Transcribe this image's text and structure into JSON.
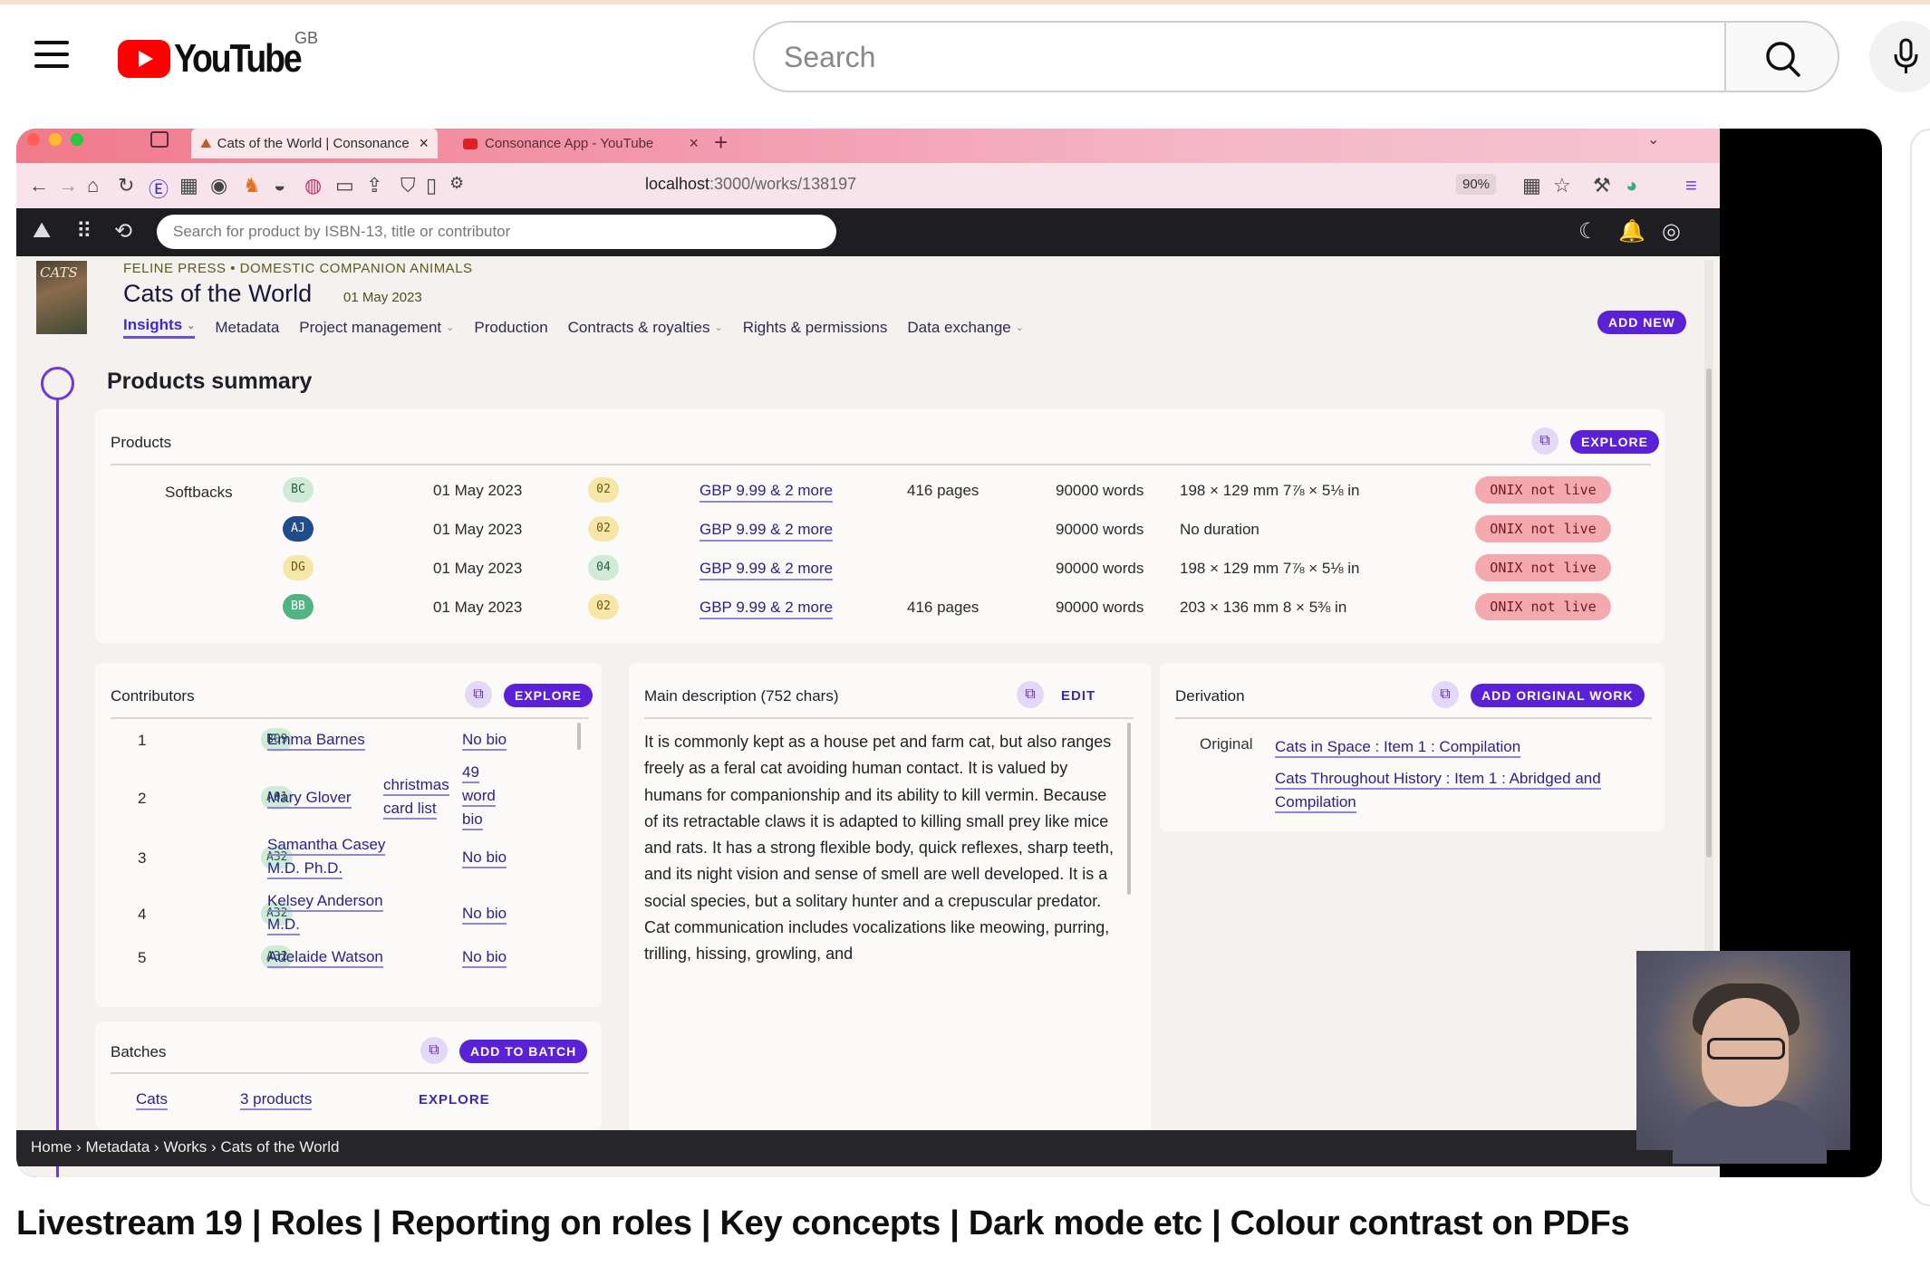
{
  "youtube": {
    "country": "GB",
    "logo_text": "YouTube",
    "search_placeholder": "Search",
    "video_title": "Livestream 19 | Roles | Reporting on roles | Key concepts | Dark mode etc | Colour contrast on PDFs"
  },
  "browser": {
    "tabs": [
      {
        "label": "Cats of the World | Consonance"
      },
      {
        "label": "Consonance App - YouTube"
      }
    ],
    "url_host": "localhost",
    "url_path": ":3000/works/138197",
    "zoom": "90%"
  },
  "app": {
    "search_placeholder": "Search for product by ISBN-13, title or contributor",
    "cover_text": "CATS",
    "imprint": "FELINE PRESS • DOMESTIC COMPANION ANIMALS",
    "work_title": "Cats of the World",
    "work_date": "01 May 2023",
    "nav": [
      {
        "label": "Insights",
        "chevron": true,
        "selected": true
      },
      {
        "label": "Metadata",
        "chevron": false
      },
      {
        "label": "Project management",
        "chevron": true
      },
      {
        "label": "Production",
        "chevron": false
      },
      {
        "label": "Contracts & royalties",
        "chevron": true
      },
      {
        "label": "Rights & permissions",
        "chevron": false
      },
      {
        "label": "Data exchange",
        "chevron": true
      }
    ],
    "add_new": "ADD NEW",
    "section_title": "Products summary",
    "products": {
      "heading": "Products",
      "explore": "EXPLORE",
      "group": "Softbacks",
      "rows": [
        {
          "code": "BC",
          "code_style": "green",
          "date": "01 May 2023",
          "status": "02",
          "status_style": "yellow",
          "price": "GBP 9.99 & 2 more",
          "pages": "416 pages",
          "words": "90000 words",
          "dims": "198 × 129 mm 7⅞ × 5⅛ in",
          "onix": "ONIX not live"
        },
        {
          "code": "AJ",
          "code_style": "blue",
          "date": "01 May 2023",
          "status": "02",
          "status_style": "yellow",
          "price": "GBP 9.99 & 2 more",
          "pages": "",
          "words": "90000 words",
          "dims": "No duration",
          "onix": "ONIX not live"
        },
        {
          "code": "DG",
          "code_style": "yellow",
          "date": "01 May 2023",
          "status": "04",
          "status_style": "green",
          "price": "GBP 9.99 & 2 more",
          "pages": "",
          "words": "90000 words",
          "dims": "198 × 129 mm 7⅞ × 5⅛ in",
          "onix": "ONIX not live"
        },
        {
          "code": "BB",
          "code_style": "teal",
          "date": "01 May 2023",
          "status": "02",
          "status_style": "yellow",
          "price": "GBP 9.99 & 2 more",
          "pages": "416 pages",
          "words": "90000 words",
          "dims": "203 × 136 mm 8 × 5⅜ in",
          "onix": "ONIX not live"
        }
      ]
    },
    "contributors": {
      "heading": "Contributors",
      "explore": "EXPLORE",
      "rows": [
        {
          "n": "1",
          "role": "B09",
          "name_lines": [
            "Emma Barnes"
          ],
          "list_lines": [],
          "bio_lines": [
            "No bio"
          ]
        },
        {
          "n": "2",
          "role": "A01",
          "name_lines": [
            "Mary Glover"
          ],
          "list_lines": [
            "christmas",
            "card list"
          ],
          "bio_lines": [
            "49",
            "word",
            "bio"
          ]
        },
        {
          "n": "3",
          "role": "A32",
          "name_lines": [
            "Samantha Casey",
            "M.D. Ph.D."
          ],
          "list_lines": [],
          "bio_lines": [
            "No bio"
          ]
        },
        {
          "n": "4",
          "role": "A32",
          "name_lines": [
            "Kelsey Anderson",
            "M.D."
          ],
          "list_lines": [],
          "bio_lines": [
            "No bio"
          ]
        },
        {
          "n": "5",
          "role": "A32",
          "name_lines": [
            "Adelaide Watson"
          ],
          "list_lines": [],
          "bio_lines": [
            "No bio"
          ]
        }
      ]
    },
    "description": {
      "heading": "Main description (752 chars)",
      "edit": "EDIT",
      "text": "It is commonly kept as a house pet and farm cat, but also ranges freely as a feral cat avoiding human contact. It is valued by humans for companionship and its ability to kill vermin. Because of its retractable claws it is adapted to killing small prey like mice and rats. It has a strong flexible body, quick reflexes, sharp teeth, and its night vision and sense of smell are well developed. It is a social species, but a solitary hunter and a crepuscular predator. Cat communication includes vocalizations like meowing, purring, trilling, hissing, growling, and"
    },
    "derivation": {
      "heading": "Derivation",
      "button": "ADD ORIGINAL WORK",
      "label": "Original",
      "links": [
        {
          "lines": [
            "Cats in Space : Item 1 : Compilation"
          ]
        },
        {
          "lines": [
            "Cats Throughout History : Item 1 : Abridged and",
            "Compilation"
          ]
        }
      ]
    },
    "batches": {
      "heading": "Batches",
      "button": "ADD TO BATCH",
      "row": {
        "name": "Cats",
        "count": "3 products",
        "explore": "EXPLORE"
      }
    },
    "breadcrumb": "Home › Metadata › Works › Cats of the World"
  }
}
